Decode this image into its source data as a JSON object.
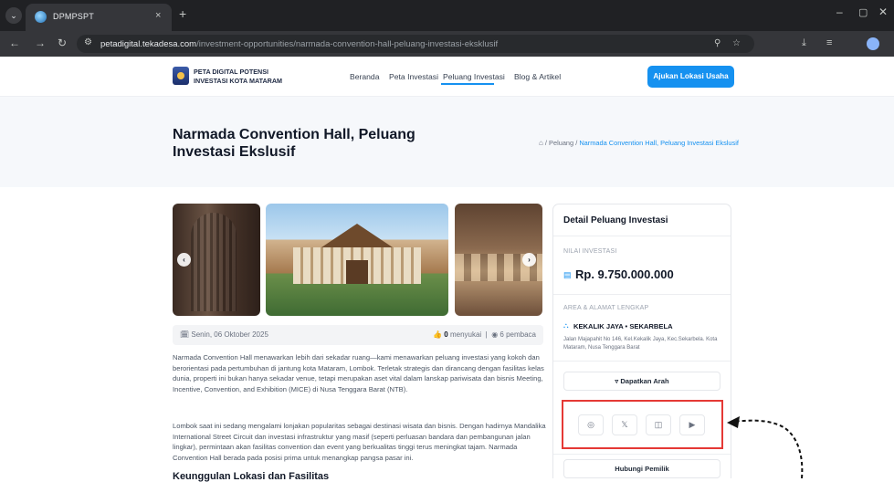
{
  "browser": {
    "tab_title": "DPMPSPT",
    "tab_close": "×",
    "new_tab": "+",
    "url_host": "petadigital.tekadesa.com",
    "url_path": "/investment-opportunities/narmada-convention-hall-peluang-investasi-eksklusif"
  },
  "header": {
    "logo_line1": "PETA DIGITAL POTENSI",
    "logo_line2": "INVESTASI KOTA MATARAM",
    "nav": [
      "Beranda",
      "Peta Investasi",
      "Peluang Investasi",
      "Blog & Artikel"
    ],
    "active_nav": "Peluang Investasi",
    "cta_label": "Ajukan Lokasi Usaha",
    "accent_color": "#1591f0"
  },
  "hero": {
    "title": "Narmada Convention Hall, Peluang Investasi Ekslusif",
    "breadcrumb_sep": "/",
    "breadcrumb_parent": "Peluang",
    "breadcrumb_current": "Narmada Convention Hall, Peluang Investasi Ekslusif"
  },
  "meta": {
    "date": "Senin, 06 Oktober 2025",
    "likes_count": "0",
    "likes_label": "menyukai",
    "views": "6 pembaca"
  },
  "article": {
    "para1": "Narmada Convention Hall menawarkan lebih dari sekadar ruang—kami menawarkan peluang investasi yang kokoh dan berorientasi pada pertumbuhan di jantung kota Mataram, Lombok. Terletak strategis dan dirancang dengan fasilitas kelas dunia, properti ini bukan hanya sekadar venue, tetapi merupakan aset vital dalam lanskap pariwisata dan bisnis Meeting, Incentive, Convention, and Exhibition (MICE) di Nusa Tenggara Barat (NTB).",
    "para2": "Lombok saat ini sedang mengalami lonjakan popularitas sebagai destinasi wisata dan bisnis. Dengan hadirnya Mandalika International Street Circuit dan investasi infrastruktur yang masif (seperti perluasan bandara dan pembangunan jalan lingkar), permintaan akan fasilitas convention dan event yang berkualitas tinggi terus meningkat tajam. Narmada Convention Hall berada pada posisi prima untuk menangkap pangsa pasar ini.",
    "section_heading": "Keunggulan Lokasi dan Fasilitas"
  },
  "sidebar": {
    "title": "Detail Peluang Investasi",
    "investment_label": "NILAI INVESTASI",
    "investment_value": "Rp. 9.750.000.000",
    "area_label": "AREA & ALAMAT LENGKAP",
    "area_value": "KEKALIK JAYA • SEKARBELA",
    "address": "Jalan Majapahit No 146, Kel.Kekalik Jaya, Kec.Sekarbela. Kota Mataram, Nusa Tenggara Barat",
    "directions_label": "Dapatkan Arah",
    "contact_label": "Hubungi Pemilik",
    "social_icons": [
      "whatsapp-icon",
      "x-icon",
      "instagram-icon",
      "youtube-icon"
    ]
  },
  "annotation": {
    "highlight_color": "#e53935"
  }
}
